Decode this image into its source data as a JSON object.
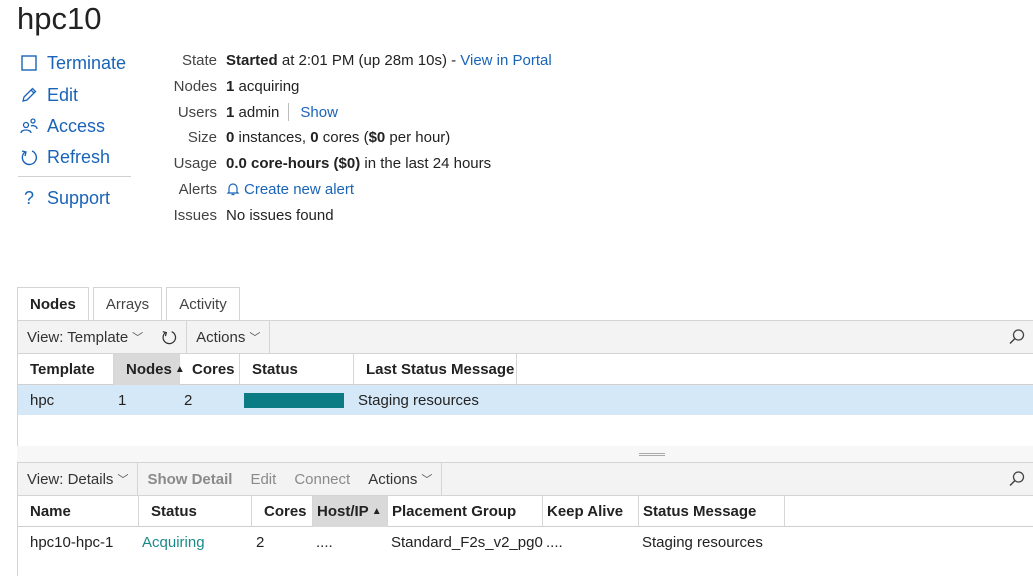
{
  "title": "hpc10",
  "sidebar": {
    "items": [
      {
        "label": "Terminate",
        "icon": "square-icon"
      },
      {
        "label": "Edit",
        "icon": "pencil-icon"
      },
      {
        "label": "Access",
        "icon": "users-icon"
      },
      {
        "label": "Refresh",
        "icon": "refresh-icon"
      },
      {
        "label": "Support",
        "icon": "question-icon"
      }
    ]
  },
  "info": {
    "state": {
      "label": "State",
      "value": "Started",
      "rest": " at 2:01 PM (up 28m 10s) - ",
      "link": "View in Portal"
    },
    "nodes": {
      "label": "Nodes",
      "count": "1",
      "rest": " acquiring"
    },
    "users": {
      "label": "Users",
      "count": "1",
      "rest": " admin",
      "link": "Show"
    },
    "size": {
      "label": "Size",
      "instances": "0",
      "t1": " instances, ",
      "cores": "0",
      "t2": " cores (",
      "cost": "$0",
      "t3": " per hour)"
    },
    "usage": {
      "label": "Usage",
      "value": "0.0 core-hours ($0)",
      "rest": " in the last 24 hours"
    },
    "alerts": {
      "label": "Alerts",
      "link": "Create new alert"
    },
    "issues": {
      "label": "Issues",
      "value": "No issues found"
    }
  },
  "tabs": [
    "Nodes",
    "Arrays",
    "Activity"
  ],
  "template_panel": {
    "toolbar": {
      "view": "View: Template",
      "actions": "Actions"
    },
    "columns": [
      "Template",
      "Nodes",
      "Cores",
      "Status",
      "Last Status Message"
    ],
    "rows": [
      {
        "template": "hpc",
        "nodes": "1",
        "cores": "2",
        "progress": 1.0,
        "message": "Staging resources"
      }
    ]
  },
  "details_panel": {
    "toolbar": {
      "view": "View: Details",
      "show_detail": "Show Detail",
      "edit": "Edit",
      "connect": "Connect",
      "actions": "Actions"
    },
    "columns": [
      "Name",
      "Status",
      "Cores",
      "Host/IP",
      "Placement Group",
      "Keep Alive",
      "Status Message"
    ],
    "rows": [
      {
        "name": "hpc10-hpc-1",
        "status": "Acquiring",
        "cores": "2",
        "host": "....",
        "placement": "Standard_F2s_v2_pg0",
        "keep_alive": "....",
        "message": "Staging resources"
      }
    ]
  },
  "colors": {
    "link": "#1a64b8",
    "progress": "#0b7b84",
    "selected_row": "#d5e8f7",
    "acquiring": "#1a8a86"
  }
}
